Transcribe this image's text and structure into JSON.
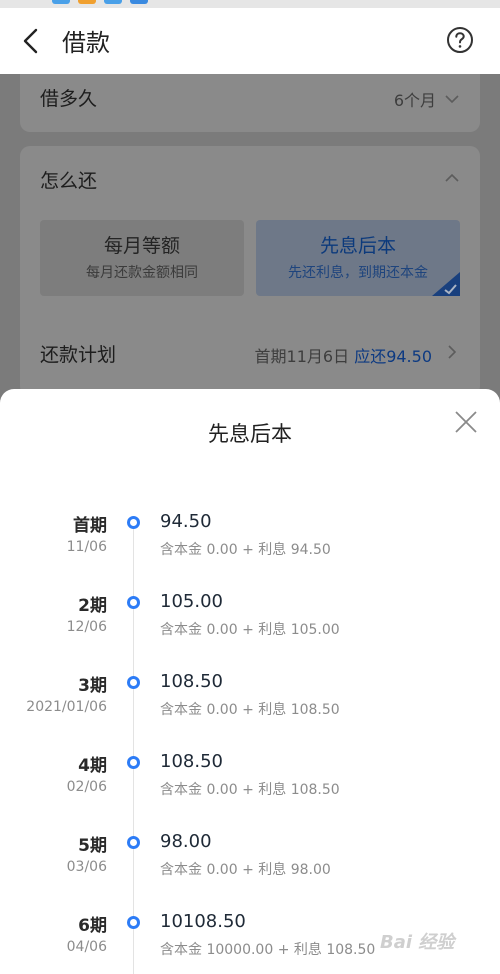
{
  "header": {
    "title": "借款"
  },
  "loan_term": {
    "label": "借多久",
    "value": "6个月"
  },
  "repay_method": {
    "label": "怎么还",
    "options": [
      {
        "title": "每月等额",
        "subtitle": "每月还款金额相同",
        "selected": false
      },
      {
        "title": "先息后本",
        "subtitle": "先还利息，到期还本金",
        "selected": true
      }
    ]
  },
  "repay_plan": {
    "label": "还款计划",
    "first_prefix": "首期11月6日",
    "due_text": "应还94.50"
  },
  "sheet": {
    "title": "先息后本",
    "items": [
      {
        "period": "首期",
        "date": "11/06",
        "amount": "94.50",
        "detail": "含本金 0.00 + 利息 94.50"
      },
      {
        "period": "2期",
        "date": "12/06",
        "amount": "105.00",
        "detail": "含本金 0.00 + 利息 105.00"
      },
      {
        "period": "3期",
        "date": "2021/01/06",
        "amount": "108.50",
        "detail": "含本金 0.00 + 利息 108.50"
      },
      {
        "period": "4期",
        "date": "02/06",
        "amount": "108.50",
        "detail": "含本金 0.00 + 利息 108.50"
      },
      {
        "period": "5期",
        "date": "03/06",
        "amount": "98.00",
        "detail": "含本金 0.00 + 利息 98.00"
      },
      {
        "period": "6期",
        "date": "04/06",
        "amount": "10108.50",
        "detail": "含本金 10000.00 + 利息 108.50"
      }
    ]
  },
  "watermark": {
    "text": "Bai 经验"
  },
  "colors": {
    "accent": "#2d7cf6",
    "overlay": "#7b7b7b",
    "sheet_bg": "#ffffff"
  },
  "icons": {
    "back": "chevron-left-icon",
    "help": "question-circle-icon",
    "close": "close-icon",
    "expand": "chevron-down-icon",
    "collapse": "chevron-up-icon",
    "next": "chevron-right-icon",
    "check": "check-corner-icon"
  }
}
